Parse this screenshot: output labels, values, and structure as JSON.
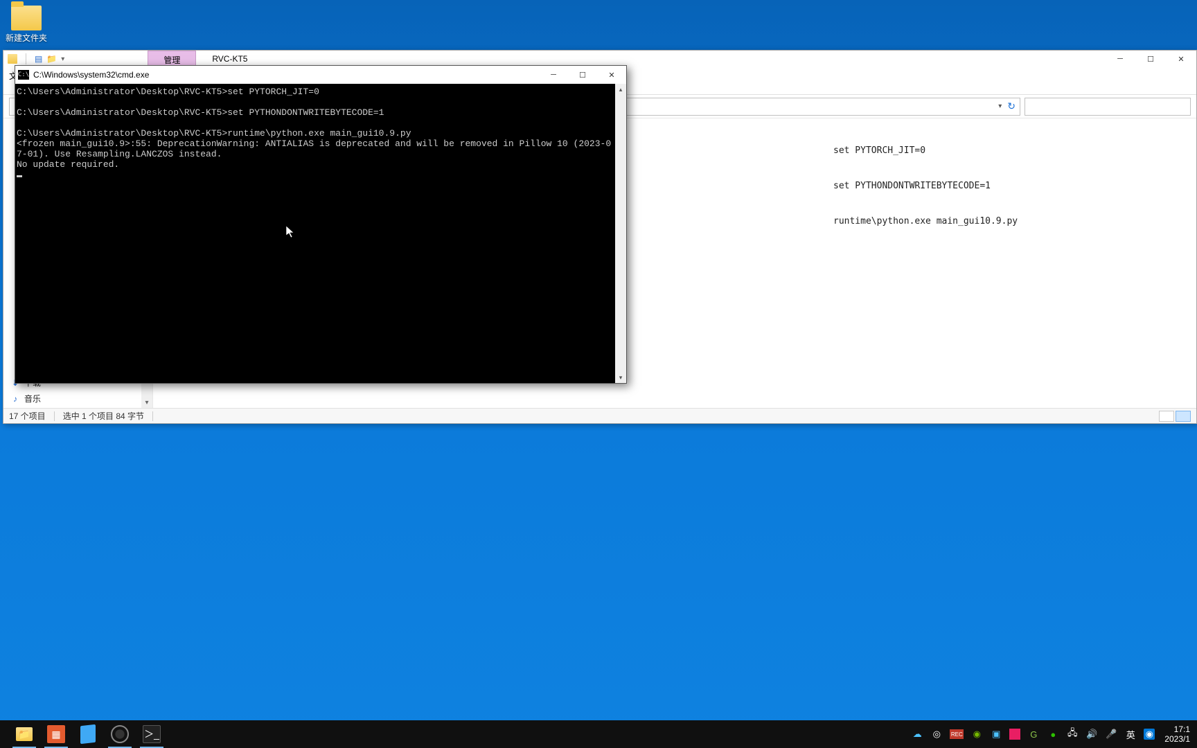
{
  "desktop": {
    "folder_label": "新建文件夹"
  },
  "explorer": {
    "tab_manage": "管理",
    "tab_title": "RVC-KT5",
    "ribbon_label_partial": "文",
    "sidebar": {
      "downloads": "下载",
      "music": "音乐"
    },
    "preview_lines": [
      "set PYTORCH_JIT=0",
      "set PYTHONDONTWRITEBYTECODE=1",
      "runtime\\python.exe main_gui10.9.py"
    ],
    "status": {
      "item_count": "17 个项目",
      "selected": "选中 1 个项目 84 字节"
    }
  },
  "cmd": {
    "title": "C:\\Windows\\system32\\cmd.exe",
    "lines": [
      "C:\\Users\\Administrator\\Desktop\\RVC-KT5>set PYTORCH_JIT=0",
      "",
      "C:\\Users\\Administrator\\Desktop\\RVC-KT5>set PYTHONDONTWRITEBYTECODE=1",
      "",
      "C:\\Users\\Administrator\\Desktop\\RVC-KT5>runtime\\python.exe main_gui10.9.py",
      "<frozen main_gui10.9>:55: DeprecationWarning: ANTIALIAS is deprecated and will be removed in Pillow 10 (2023-07-01). Use Resampling.LANCZOS instead.",
      "No update required."
    ]
  },
  "taskbar": {
    "ime": "英",
    "time": "17:1",
    "date": "2023/1"
  }
}
